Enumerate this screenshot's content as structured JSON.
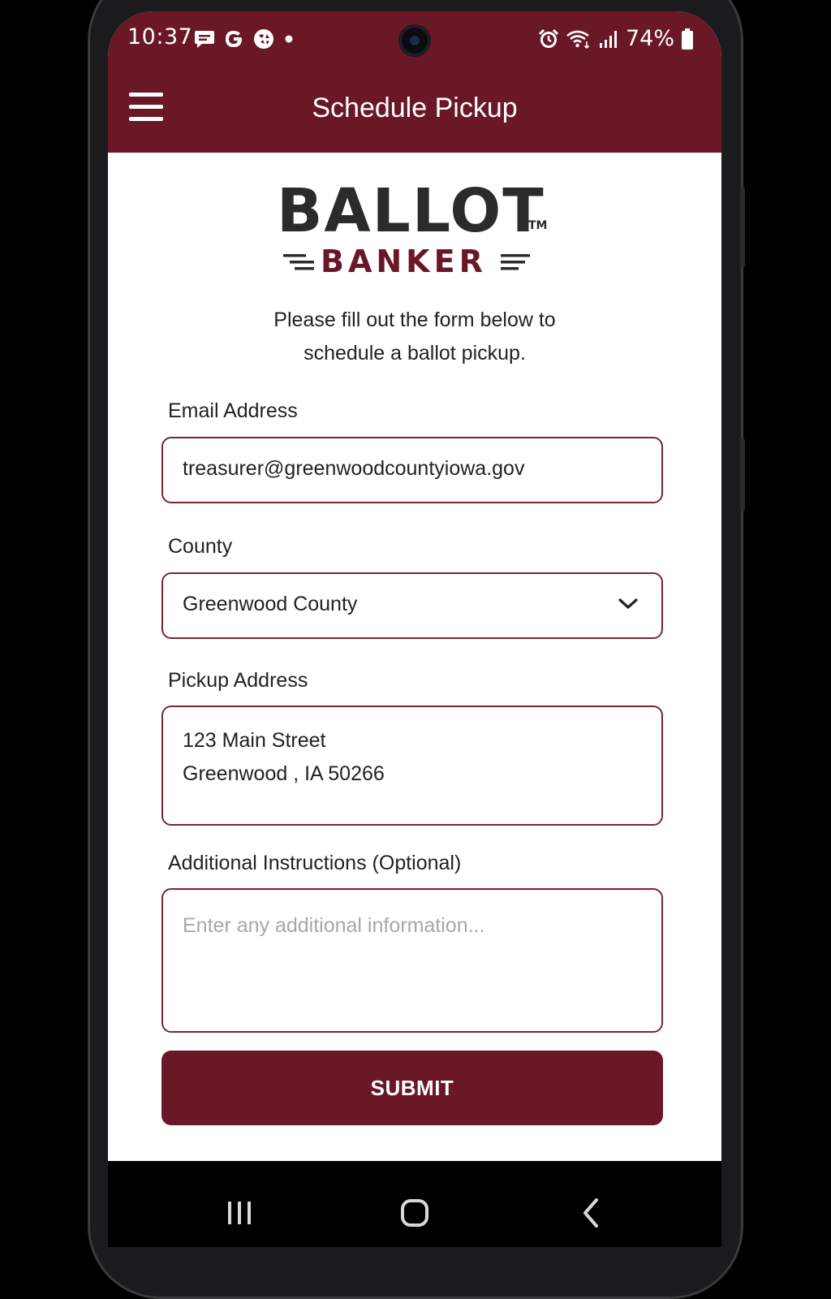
{
  "status_bar": {
    "time": "10:37",
    "battery": "74%",
    "left_icons": [
      "message-icon",
      "google-icon",
      "assistant-icon",
      "dot-icon"
    ],
    "right_icons": [
      "alarm-icon",
      "wifi-icon",
      "signal-icon",
      "battery-icon"
    ]
  },
  "app_bar": {
    "title": "Schedule Pickup",
    "menu_icon": "hamburger-menu-icon"
  },
  "logo": {
    "line1": "BALLOT",
    "tm": "TM",
    "line2": "BANKER"
  },
  "intro": {
    "line1": "Please fill out the form below to",
    "line2": "schedule a ballot pickup."
  },
  "form": {
    "email": {
      "label": "Email Address",
      "value": "treasurer@greenwoodcountyiowa.gov"
    },
    "county": {
      "label": "County",
      "value": "Greenwood County"
    },
    "pickup_address": {
      "label": "Pickup Address",
      "line1": "123 Main Street",
      "line2": "Greenwood , IA 50266"
    },
    "additional": {
      "label": "Additional Instructions",
      "optional": "(Optional)",
      "placeholder": "Enter any additional information..."
    },
    "submit_label": "SUBMIT"
  },
  "colors": {
    "brand": "#6a1727",
    "logo_dark": "#2c2b2b",
    "text": "#222222",
    "placeholder": "#a8a8a8"
  },
  "nav_bar": {
    "icons": [
      "recents-icon",
      "home-icon",
      "back-icon"
    ]
  }
}
